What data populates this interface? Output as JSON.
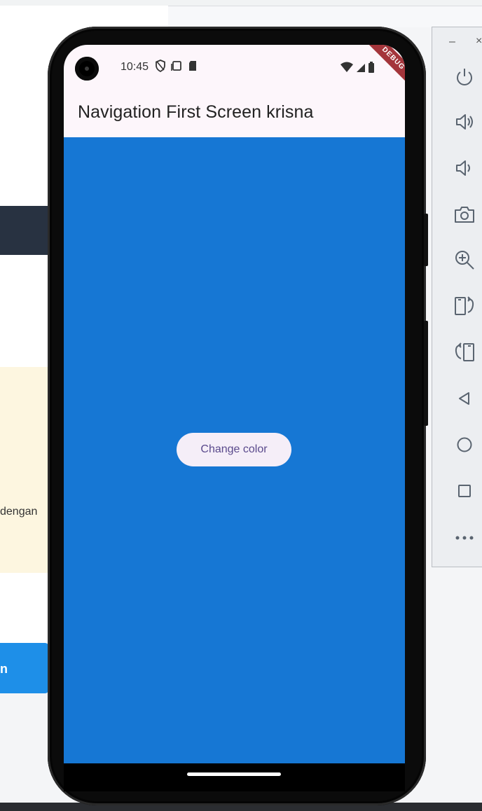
{
  "background": {
    "notice_text_fragment": "dengan",
    "button_label_fragment": "n"
  },
  "phone": {
    "status_bar": {
      "time": "10:45",
      "icons": [
        "shield-icon",
        "screen-icon",
        "sd-card-icon"
      ],
      "right_icons": [
        "wifi-icon",
        "signal-icon",
        "battery-icon"
      ]
    },
    "debug_banner": "DEBUG",
    "app_bar": {
      "title": "Navigation First Screen krisna"
    },
    "body": {
      "background_color": "#1677d4",
      "button_label": "Change color"
    }
  },
  "emulator_toolbar": {
    "window_controls": {
      "minimize": "–",
      "close": "×"
    },
    "buttons": [
      "power-icon",
      "volume-up-icon",
      "volume-down-icon",
      "camera-icon",
      "zoom-icon",
      "rotate-right-icon",
      "rotate-left-icon",
      "back-icon",
      "home-icon",
      "overview-icon",
      "more-icon"
    ]
  }
}
